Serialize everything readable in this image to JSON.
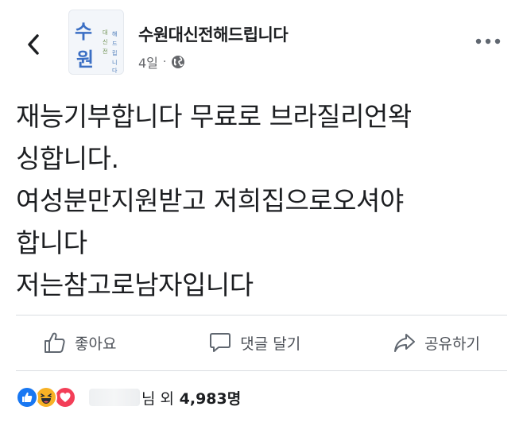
{
  "header": {
    "page_name": "수원대신전해드립니다",
    "time": "4일",
    "separator": "·",
    "avatar": {
      "big_char_top": "수",
      "big_char_bottom": "원",
      "side_text": "대신전해드립니다"
    }
  },
  "post": {
    "lines": [
      "재능기부합니다 무료로 브라질리언왁",
      "싱합니다.",
      "여성분만지원받고 저희집으로오셔야",
      "합니다",
      "저는참고로남자입니다"
    ]
  },
  "actions": {
    "like_label": "좋아요",
    "comment_label": "댓글 달기",
    "share_label": "공유하기"
  },
  "reactions": {
    "suffix": "님 외",
    "count": "4,983명"
  },
  "colors": {
    "accent": "#1877f2",
    "haha": "#f7b125",
    "love": "#f33e58",
    "text": "#1c1e21",
    "muted": "#65676b"
  },
  "icons": [
    "back-arrow-icon",
    "globe-icon",
    "more-icon",
    "like-icon",
    "comment-icon",
    "share-icon"
  ]
}
